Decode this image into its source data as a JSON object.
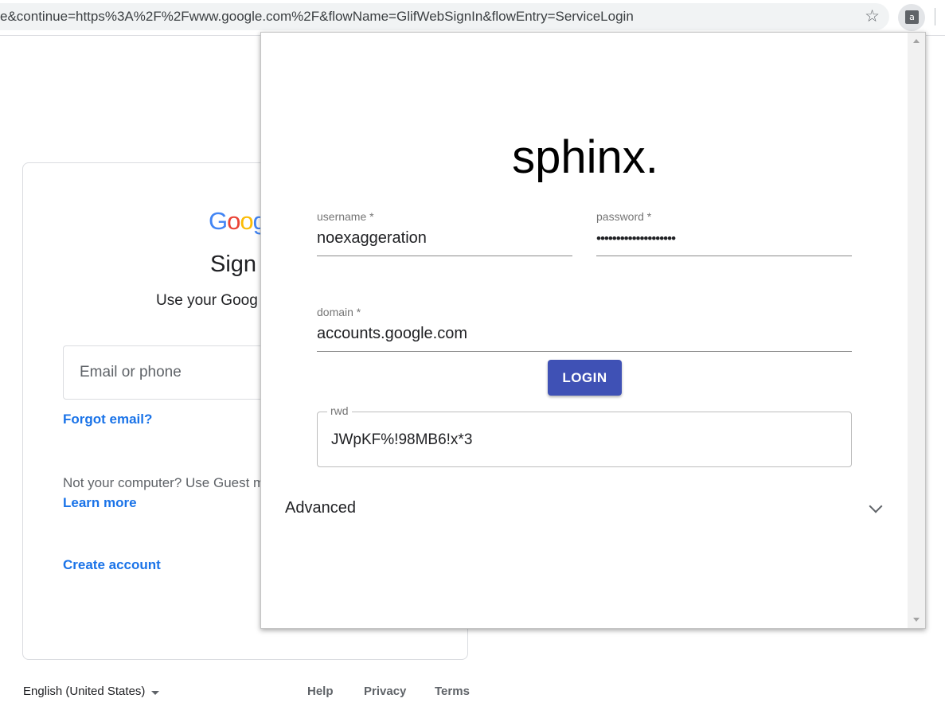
{
  "browser": {
    "url": "e&continue=https%3A%2F%2Fwww.google.com%2F&flowName=GlifWebSignIn&flowEntry=ServiceLogin",
    "star_icon": "bookmark-star-icon",
    "extension_icon_letter": "a"
  },
  "google": {
    "logo": [
      "G",
      "o",
      "o",
      "g"
    ],
    "logo_colors": [
      "#4285f4",
      "#ea4335",
      "#fbbc05",
      "#4285f4"
    ],
    "title": "Sign",
    "subtitle": "Use your Goog",
    "email_placeholder": "Email or phone",
    "forgot_email": "Forgot email?",
    "guest_text": "Not your computer? Use Guest m",
    "learn_more": "Learn more",
    "create_account": "Create account",
    "footer": {
      "language": "English (United States)",
      "help": "Help",
      "privacy": "Privacy",
      "terms": "Terms"
    }
  },
  "sphinx": {
    "title": "sphinx.",
    "username_label": "username *",
    "username_value": "noexaggeration",
    "password_label": "password *",
    "password_value": "••••••••••••••••••••",
    "domain_label": "domain *",
    "domain_value": "accounts.google.com",
    "login_label": "LOGIN",
    "rwd_label": "rwd",
    "rwd_value": "JWpKF%!98MB6!x*3",
    "advanced_label": "Advanced",
    "accent_color": "#3f51b5"
  }
}
